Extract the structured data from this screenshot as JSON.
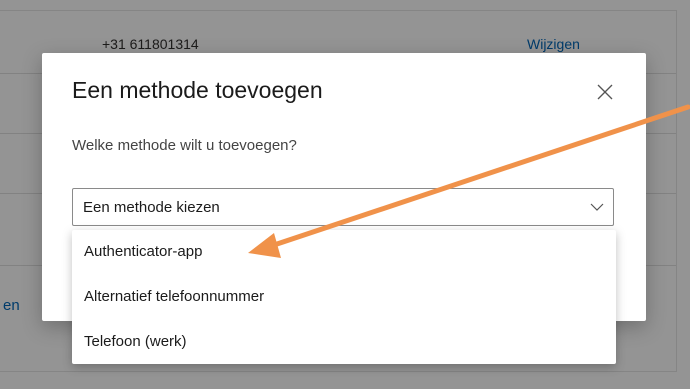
{
  "background": {
    "phone_number": "+31 611801314",
    "change_link": "Wijzigen",
    "edge_link": "en"
  },
  "dialog": {
    "title": "Een methode toevoegen",
    "question": "Welke methode wilt u toevoegen?",
    "select": {
      "selected_value": "Een methode kiezen",
      "options": [
        "Authenticator-app",
        "Alternatief telefoonnummer",
        "Telefoon (werk)"
      ]
    },
    "close_icon": "close-icon"
  },
  "annotation": {
    "arrow_color": "#f0924a"
  }
}
